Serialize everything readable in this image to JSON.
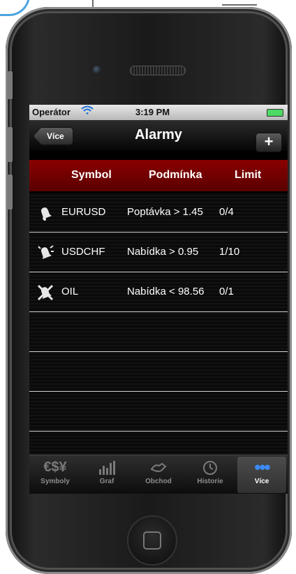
{
  "statusbar": {
    "carrier": "Operátor",
    "time": "3:19 PM"
  },
  "navbar": {
    "back_label": "Více",
    "title": "Alarmy",
    "add_label": "+"
  },
  "table": {
    "columns": [
      "Symbol",
      "Podmínka",
      "Limit"
    ],
    "rows": [
      {
        "icon": "bell-icon",
        "symbol": "EURUSD",
        "condition": "Poptávka > 1.45",
        "limit": "0/4"
      },
      {
        "icon": "ringing-bell-icon",
        "symbol": "USDCHF",
        "condition": "Nabídka > 0.95",
        "limit": "1/10"
      },
      {
        "icon": "muted-bell-icon",
        "symbol": "OIL",
        "condition": "Nabídka < 98.56",
        "limit": "0/1"
      }
    ]
  },
  "tabbar": {
    "tabs": [
      {
        "label": "Symboly",
        "icon": "currency-icon"
      },
      {
        "label": "Graf",
        "icon": "chart-icon"
      },
      {
        "label": "Obchod",
        "icon": "trade-icon"
      },
      {
        "label": "Historie",
        "icon": "clock-icon"
      },
      {
        "label": "Více",
        "icon": "more-dots-icon",
        "active": true
      }
    ]
  },
  "colors": {
    "header_red": "#7a0000",
    "active_tab_blue": "#3d8af7",
    "statusbar_gray": "#d0d0d0"
  }
}
